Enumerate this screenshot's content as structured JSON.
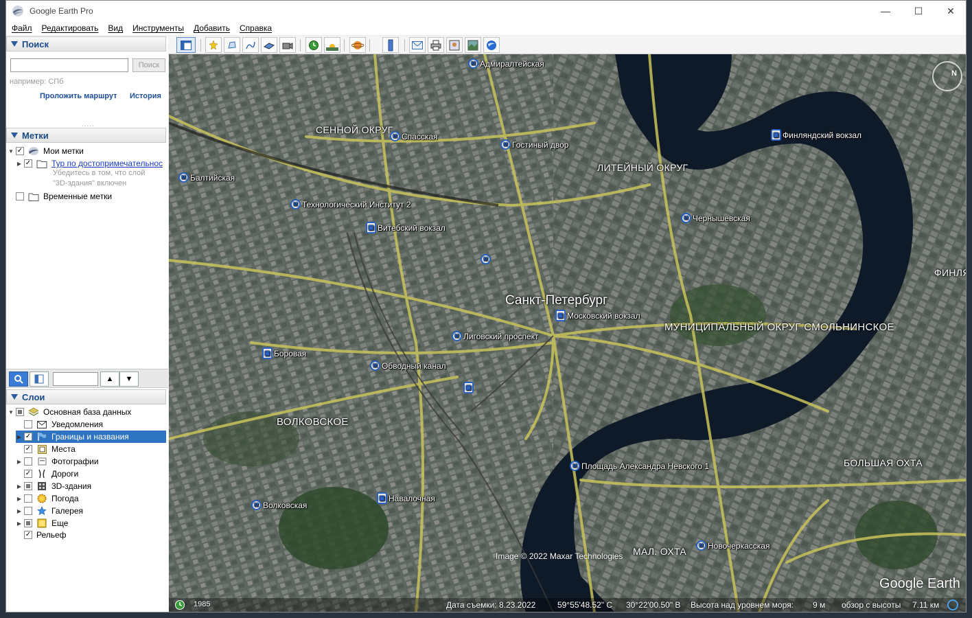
{
  "window": {
    "title": "Google Earth Pro",
    "minimize": "—",
    "maximize": "☐",
    "close": "✕"
  },
  "menu": [
    "Файл",
    "Редактировать",
    "Вид",
    "Инструменты",
    "Добавить",
    "Справка"
  ],
  "search": {
    "title": "Поиск",
    "input_value": "",
    "button_label": "Поиск",
    "hint": "например: СПб",
    "route_link": "Проложить маршрут",
    "history_link": "История"
  },
  "places": {
    "title": "Метки",
    "my_places": "Мои метки",
    "tour": "Тур по достопримечательнос",
    "tour_note_1": "Убедитесь в том, что слой",
    "tour_note_2": "\"3D-здания\" включен",
    "temp_places": "Временные метки"
  },
  "layers": {
    "title": "Слои",
    "items": [
      "Основная база данных",
      "Уведомления",
      "Границы и названия",
      "Места",
      "Фотографии",
      "Дороги",
      "3D-здания",
      "Погода",
      "Галерея",
      "Еще",
      "Рельеф"
    ]
  },
  "map": {
    "city": "Санкт-Петербург",
    "districts": [
      "СЕННОЙ ОКРУГ",
      "ЛИТЕЙНЫЙ ОКРУГ",
      "МУНИЦИПАЛЬНЫЙ ОКРУГ СМОЛЬНИНСКОЕ",
      "ВОЛКОВСКОЕ",
      "БОЛЬШАЯ ОХТА",
      "МАЛ. ОХТА",
      "ФИНЛЯ"
    ],
    "stations": [
      "Адмиралтейская",
      "Спасская",
      "Гостиный двор",
      "Финляндский вокзал",
      "Балтийская",
      "Технологический Институт 2",
      "Витебский вокзал",
      "Чернышевская",
      "Московский вокзал",
      "Лиговский проспект",
      "Боровая",
      "Обводный канал",
      "Площадь Александра Невского 1",
      "Волковская",
      "Навалочная",
      "Новочеркасская"
    ],
    "attribution": "Image © 2022 Maxar Technologies",
    "brand": "Google Earth",
    "compass_label": "N"
  },
  "status": {
    "year": "1985",
    "date": "Дата съемки: 8.23.2022",
    "lat": "59°55'48.52\" С",
    "lon": "30°22'00.50\" В",
    "elevation_label": "Высота над уровнем моря:",
    "elevation_value": "9 м",
    "eye_label": "обзор с высоты",
    "eye_value": "7.11 км"
  }
}
